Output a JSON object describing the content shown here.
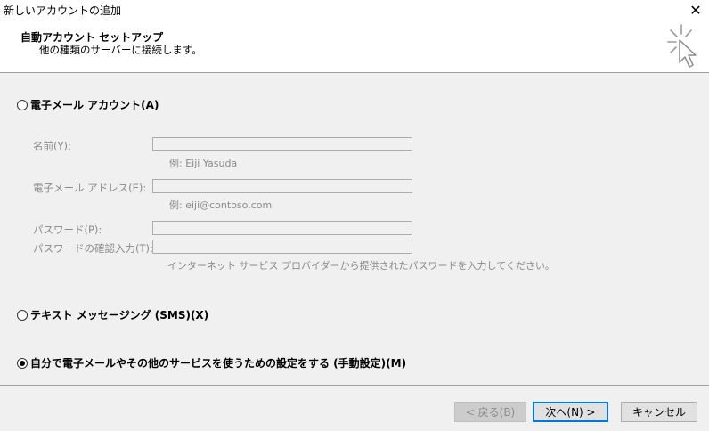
{
  "window": {
    "title": "新しいアカウントの追加",
    "close_glyph": "✕"
  },
  "header": {
    "title": "自動アカウント セットアップ",
    "subtitle": "他の種類のサーバーに接続します。",
    "icon": "setup-wizard-cursor-icon"
  },
  "options": {
    "email_account": {
      "label": "電子メール アカウント(A)",
      "selected": false
    },
    "sms": {
      "label": "テキスト メッセージング (SMS)(X)",
      "selected": false
    },
    "manual": {
      "label": "自分で電子メールやその他のサービスを使うための設定をする (手動設定)(M)",
      "selected": true
    }
  },
  "form": {
    "name_label": "名前(Y):",
    "name_value": "",
    "name_hint": "例: Eiji Yasuda",
    "email_label": "電子メール アドレス(E):",
    "email_value": "",
    "email_hint": "例: eiji@contoso.com",
    "password_label": "パスワード(P):",
    "password_value": "",
    "password_confirm_label": "パスワードの確認入力(T):",
    "password_confirm_value": "",
    "password_hint": "インターネット サービス プロバイダーから提供されたパスワードを入力してください。"
  },
  "buttons": {
    "back": "< 戻る(B)",
    "next": "次へ(N) >",
    "cancel": "キャンセル"
  },
  "colors": {
    "focus_border": "#0078d7",
    "disabled_text": "#8a8a8a"
  }
}
